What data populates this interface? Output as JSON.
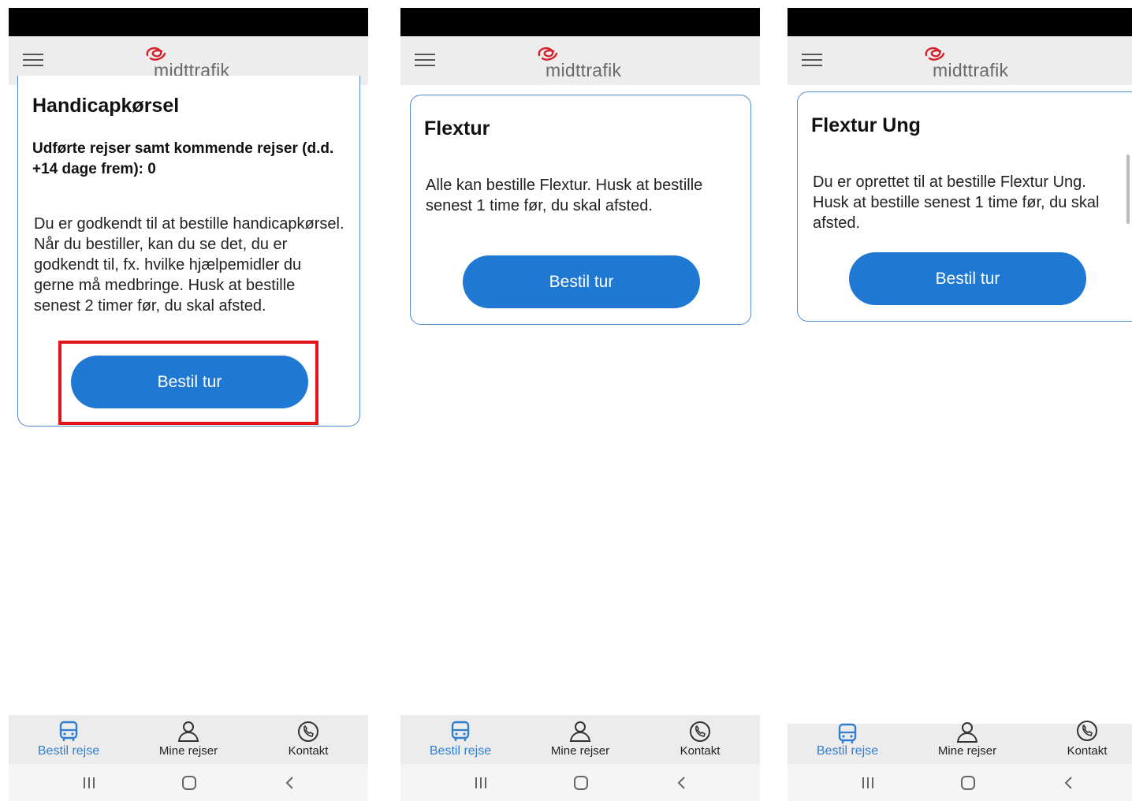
{
  "brand": {
    "logo_text": "midttrafik",
    "accent_color": "#1f78d1",
    "logo_color": "#d6202b"
  },
  "screens": [
    {
      "card": {
        "title": "Handicapkørsel",
        "subtitle": "Udførte rejser samt kommende rejser (d.d. +14 dage frem): 0",
        "description": "Du er godkendt til at bestille handicapkørsel. Når du bestiller, kan du se det, du er godkendt til, fx. hvilke hjælpemidler du gerne må medbringe. Husk at bestille senest 2 timer før, du skal afsted.",
        "button_label": "Bestil tur",
        "button_highlighted": true
      },
      "tabs": [
        {
          "label": "Bestil rejse",
          "icon": "bus-icon",
          "active": true
        },
        {
          "label": "Mine rejser",
          "icon": "person-icon",
          "active": false
        },
        {
          "label": "Kontakt",
          "icon": "phone-icon",
          "active": false
        }
      ]
    },
    {
      "card": {
        "title": "Flextur",
        "description": "Alle kan bestille Flextur. Husk at bestille senest 1 time før, du skal afsted.",
        "button_label": "Bestil tur"
      },
      "tabs": [
        {
          "label": "Bestil rejse",
          "icon": "bus-icon",
          "active": true
        },
        {
          "label": "Mine rejser",
          "icon": "person-icon",
          "active": false
        },
        {
          "label": "Kontakt",
          "icon": "phone-icon",
          "active": false
        }
      ]
    },
    {
      "card": {
        "title": "Flextur Ung",
        "description": "Du er oprettet til at bestille Flextur Ung. Husk at bestille senest 1 time før, du skal afsted.",
        "button_label": "Bestil tur"
      },
      "tabs": [
        {
          "label": "Bestil rejse",
          "icon": "bus-icon",
          "active": true
        },
        {
          "label": "Mine rejser",
          "icon": "person-icon",
          "active": false
        },
        {
          "label": "Kontakt",
          "icon": "phone-icon",
          "active": false
        }
      ]
    }
  ],
  "system_nav": {
    "icons": [
      "recents-icon",
      "home-icon",
      "back-icon"
    ]
  }
}
